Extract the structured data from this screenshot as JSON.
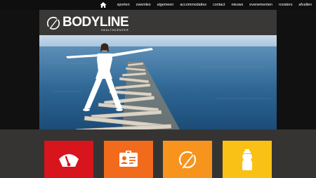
{
  "nav": {
    "home_icon": "home-icon",
    "items": [
      {
        "label": "sporten"
      },
      {
        "label": "zwemles"
      },
      {
        "label": "algemeen"
      },
      {
        "label": "accommodaties"
      },
      {
        "label": "contact"
      },
      {
        "label": "nieuws"
      },
      {
        "label": "evenementen"
      },
      {
        "label": "roosters"
      },
      {
        "label": "afvallen"
      }
    ]
  },
  "brand": {
    "name": "BODYLINE",
    "tagline": "HEALTHCENTER",
    "logo_icon": "bodyline-logo-icon"
  },
  "hero": {
    "image": "woman-yoga-pose-on-wooden-pier-photo"
  },
  "tiles": [
    {
      "icon": "scale-gauge-icon",
      "color": "#d8141c"
    },
    {
      "icon": "id-card-icon",
      "color": "#f26a1c"
    },
    {
      "icon": "bodyline-logo-icon",
      "color": "#f7941d"
    },
    {
      "icon": "water-bottle-icon",
      "color": "#f9c116"
    }
  ],
  "colors": {
    "topbar": "#0f0f0f",
    "background": "#363432",
    "header_panel": "#3a3836"
  }
}
